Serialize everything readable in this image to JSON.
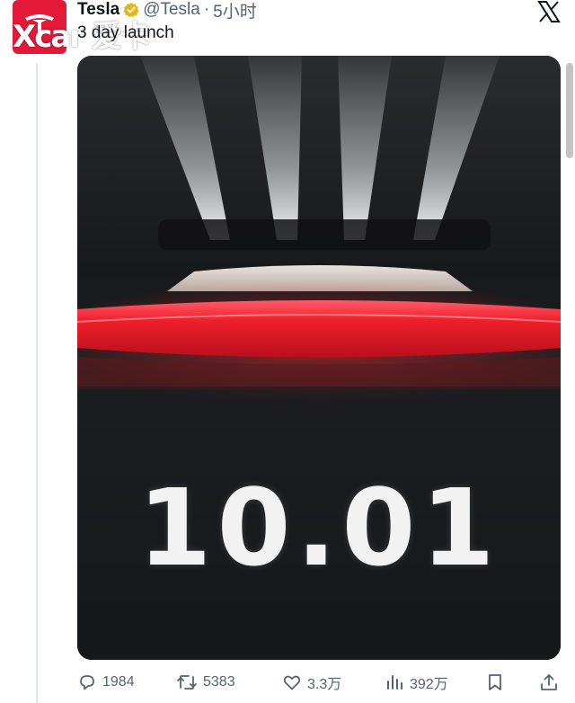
{
  "header": {
    "name": "Tesla",
    "handle": "@Tesla",
    "separator": "·",
    "time": "5小时"
  },
  "tweet": {
    "text": "3 day launch"
  },
  "watermark": {
    "text": "Xcar 爱卡"
  },
  "media": {
    "date_text": "10.01"
  },
  "actions": {
    "replies": "1984",
    "retweets": "5383",
    "likes": "3.3万",
    "views": "392万"
  },
  "icons": {
    "verified": "verified-badge-icon",
    "x_logo": "x-logo-icon",
    "reply": "reply-icon",
    "retweet": "retweet-icon",
    "like": "heart-icon",
    "views": "views-icon",
    "bookmark": "bookmark-icon",
    "share": "share-icon"
  },
  "colors": {
    "brand_red": "#e31937",
    "verified_gold": "#e2b719",
    "muted_text": "#536471"
  }
}
